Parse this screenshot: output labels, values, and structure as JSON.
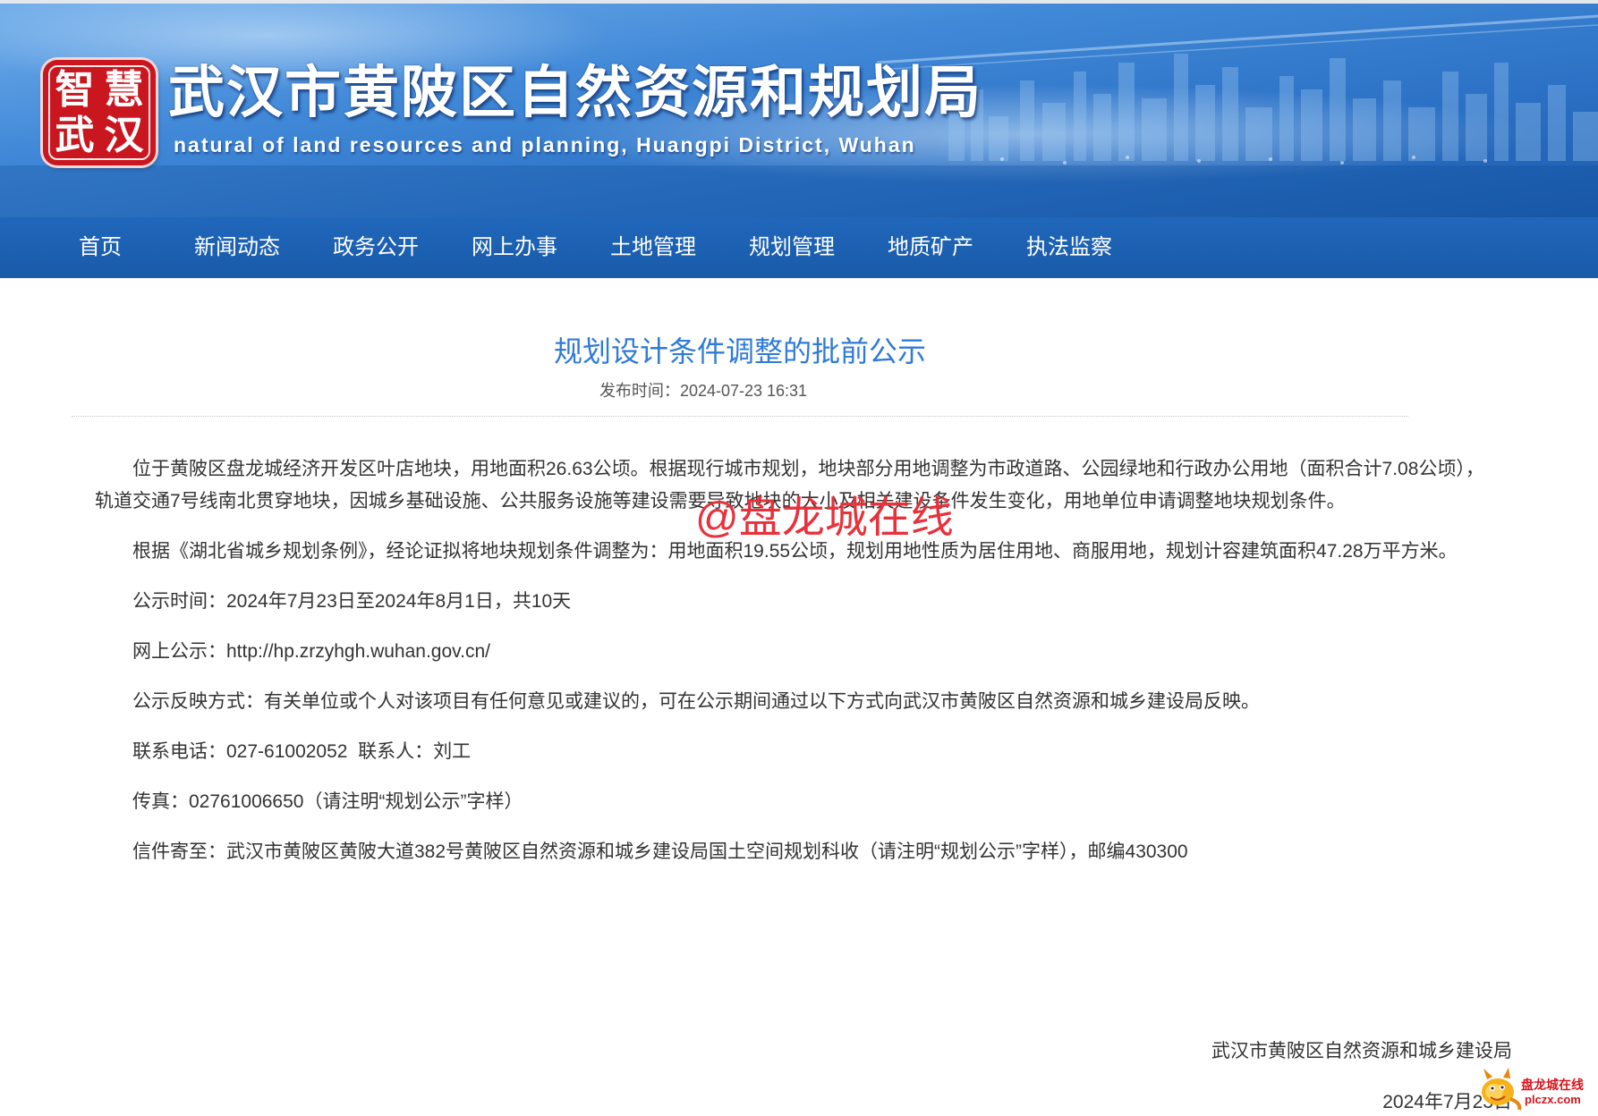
{
  "header": {
    "logo": {
      "chars": [
        "智",
        "慧",
        "武",
        "汉"
      ]
    },
    "title": "武汉市黄陂区自然资源和规划局",
    "subtitle": "natural of land resources and planning, Huangpi District, Wuhan"
  },
  "nav": {
    "items": [
      {
        "label": "首页"
      },
      {
        "label": "新闻动态"
      },
      {
        "label": "政务公开"
      },
      {
        "label": "网上办事"
      },
      {
        "label": "土地管理"
      },
      {
        "label": "规划管理"
      },
      {
        "label": "地质矿产"
      },
      {
        "label": "执法监察"
      }
    ]
  },
  "article": {
    "title": "规划设计条件调整的批前公示",
    "publish_label": "发布时间：",
    "publish_time": "2024-07-23 16:31",
    "paragraphs": [
      "位于黄陂区盘龙城经济开发区叶店地块，用地面积26.63公顷。根据现行城市规划，地块部分用地调整为市政道路、公园绿地和行政办公用地（面积合计7.08公顷），轨道交通7号线南北贯穿地块，因城乡基础设施、公共服务设施等建设需要导致地块的大小及相关建设条件发生变化，用地单位申请调整地块规划条件。",
      "根据《湖北省城乡规划条例》，经论证拟将地块规划条件调整为：用地面积19.55公顷，规划用地性质为居住用地、商服用地，规划计容建筑面积47.28万平方米。",
      "公示时间：2024年7月23日至2024年8月1日，共10天",
      "网上公示：http://hp.zrzyhgh.wuhan.gov.cn/",
      "公示反映方式：有关单位或个人对该项目有任何意见或建议的，可在公示期间通过以下方式向武汉市黄陂区自然资源和城乡建设局反映。",
      "联系电话：027-61002052  联系人：刘工",
      "传真：02761006650（请注明“规划公示”字样）",
      "信件寄至：武汉市黄陂区黄陂大道382号黄陂区自然资源和城乡建设局国土空间规划科收（请注明“规划公示”字样），邮编430300"
    ]
  },
  "signature": {
    "org": "武汉市黄陂区自然资源和城乡建设局",
    "date": "2024年7月23日"
  },
  "watermark": {
    "text": "@盘龙城在线"
  },
  "site_badge": {
    "name": "盘龙城在线",
    "domain": "plczx.com",
    "icon": "dragon-mascot-icon"
  },
  "colors": {
    "nav_bg": "#1d62b5",
    "article_title": "#2f7bd6",
    "watermark": "#e8313a",
    "seal": "#c9161f"
  }
}
